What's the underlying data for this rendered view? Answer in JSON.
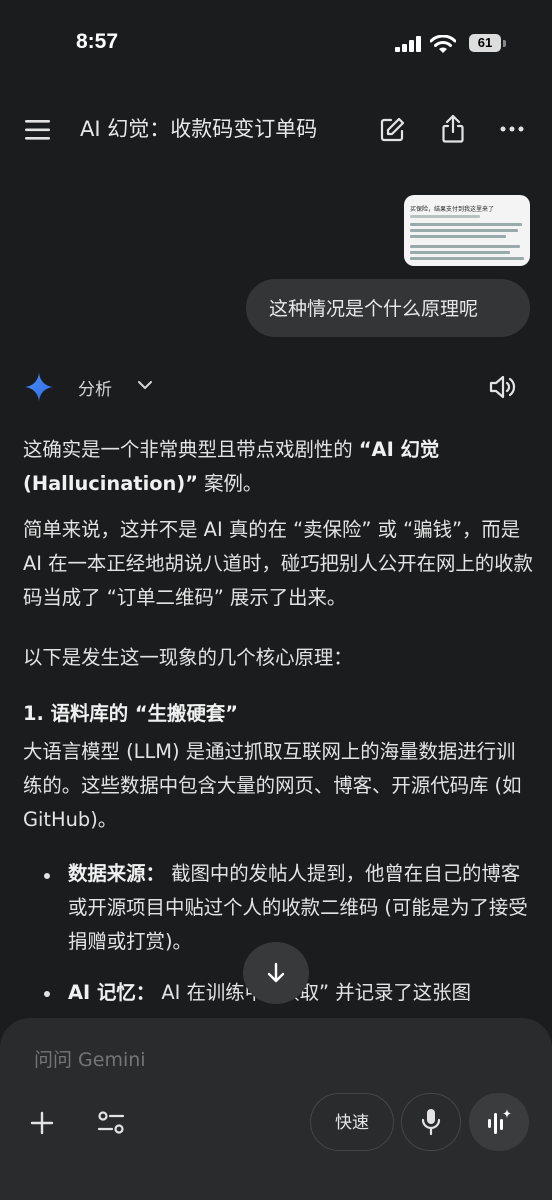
{
  "status": {
    "time": "8:57",
    "battery": "61"
  },
  "header": {
    "title": "AI 幻觉：收款码变订单码"
  },
  "user": {
    "message": "这种情况是个什么原理呢"
  },
  "attachment": {
    "caption": "买保险，结果支付到我这里来了"
  },
  "model": {
    "mode": "分析"
  },
  "response": {
    "p1": [
      "这确实是一个非常典型且带点戏剧性的 ",
      "“AI 幻觉 (Hallucination)”",
      " 案例。"
    ],
    "p2": "简单来说，这并不是 AI 真的在 “卖保险” 或 “骗钱”，而是 AI 在一本正经地胡说八道时，碰巧把别人公开在网上的收款码当成了 “订单二维码” 展示了出来。",
    "p3": "以下是发生这一现象的几个核心原理：",
    "h1": "1. 语料库的 “生搬硬套”",
    "p4": "大语言模型 (LLM) 是通过抓取互联网上的海量数据进行训练的。这些数据中包含大量的网页、博客、开源代码库 (如 GitHub)。",
    "bullets": [
      {
        "label": "数据来源：",
        "text": " 截图中的发帖人提到，他曾在自己的博客或开源项目中贴过个人的收款二维码 (可能是为了接受捐赠或打赏)。"
      },
      {
        "label": "AI 记忆：",
        "text": " AI 在训练中 “读取” 并记录了这张图"
      }
    ]
  },
  "input": {
    "placeholder": "问问 Gemini",
    "speed_label": "快速"
  }
}
